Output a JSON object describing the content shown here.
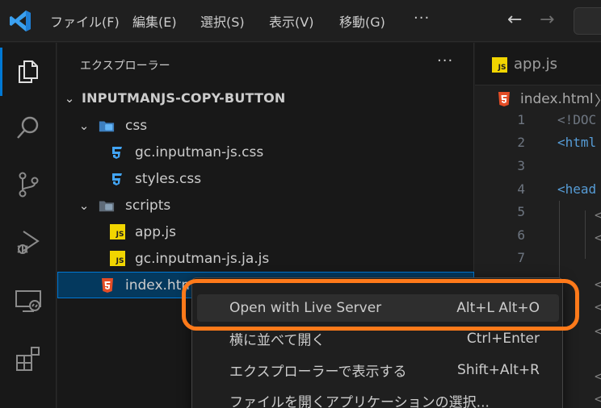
{
  "menubar": {
    "items": [
      "ファイル(F)",
      "編集(E)",
      "選択(S)",
      "表示(V)",
      "移動(G)"
    ],
    "more": "···"
  },
  "nav": {
    "back": "←",
    "forward": "→"
  },
  "activity": [
    "explorer-icon",
    "search-icon",
    "source-control-icon",
    "run-debug-icon",
    "remote-explorer-icon",
    "extensions-icon"
  ],
  "sidebar": {
    "title": "エクスプローラー",
    "more": "···",
    "root": "INPUTMANJS-COPY-BUTTON",
    "tree": [
      {
        "label": "css",
        "kind": "folder"
      },
      {
        "label": "gc.inputman-js.css",
        "kind": "css"
      },
      {
        "label": "styles.css",
        "kind": "css"
      },
      {
        "label": "scripts",
        "kind": "folder"
      },
      {
        "label": "app.js",
        "kind": "js"
      },
      {
        "label": "gc.inputman-js.ja.js",
        "kind": "js"
      },
      {
        "label": "index.html",
        "kind": "html"
      }
    ],
    "js_badge": "JS"
  },
  "editor": {
    "tab": "app.js",
    "breadcrumb": "index.html",
    "breadcrumb_sep": "〉",
    "line_numbers": [
      "1",
      "2",
      "3",
      "4",
      "5",
      "6",
      "7"
    ],
    "code": {
      "line1": "<!DOC",
      "line2": "<html",
      "line4": "<head"
    }
  },
  "context_menu": {
    "items": [
      {
        "label": "Open with Live Server",
        "shortcut": "Alt+L Alt+O"
      },
      {
        "label": "横に並べて開く",
        "shortcut": "Ctrl+Enter"
      },
      {
        "label": "エクスプローラーで表示する",
        "shortcut": "Shift+Alt+R"
      },
      {
        "label": "ファイルを開くアプリケーションの選択...",
        "shortcut": ""
      }
    ]
  },
  "colors": {
    "accent": "#0078d4",
    "highlight": "#ff7a1a",
    "js": "#f1d500",
    "css": "#42a5f5",
    "html": "#e44d26"
  }
}
